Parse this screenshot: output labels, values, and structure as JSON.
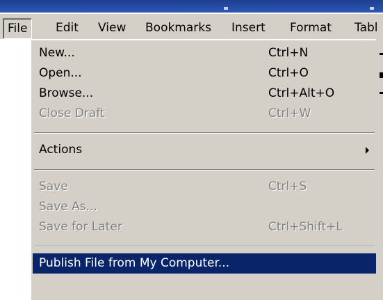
{
  "menubar": {
    "items": [
      "File",
      "Edit",
      "View",
      "Bookmarks",
      "Insert",
      "Format",
      "Tabl"
    ],
    "active": "File"
  },
  "file_menu": {
    "new_label": "New...",
    "new_shortcut": "Ctrl+N",
    "open_label": "Open...",
    "open_shortcut": "Ctrl+O",
    "browse_label": "Browse...",
    "browse_shortcut": "Ctrl+Alt+O",
    "close_draft_label": "Close Draft",
    "close_draft_shortcut": "Ctrl+W",
    "actions_label": "Actions",
    "save_label": "Save",
    "save_shortcut": "Ctrl+S",
    "save_as_label": "Save As...",
    "save_for_later_label": "Save for Later",
    "save_for_later_shortcut": "Ctrl+Shift+L",
    "publish_label": "Publish File from My Computer..."
  },
  "colors": {
    "menu_bg": "#d4d0c8",
    "highlight_bg": "#0a246a",
    "disabled_text": "#808080"
  }
}
